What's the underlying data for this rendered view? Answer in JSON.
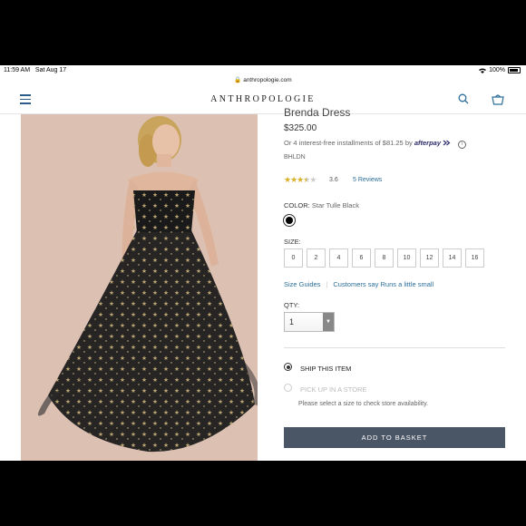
{
  "status": {
    "time": "11:59 AM",
    "date": "Sat Aug 17",
    "battery": "100%"
  },
  "browser": {
    "url": "anthropologie.com"
  },
  "header": {
    "logo": "ANTHROPOLOGIE"
  },
  "product": {
    "title": "Brenda Dress",
    "price": "$325.00",
    "installments": "Or 4 interest-free installments of $81.25 by",
    "afterpay": "afterpay",
    "brand": "BHLDN",
    "rating": "3.6",
    "rating_value": 3.6,
    "reviews": "5 Reviews",
    "color_label": "COLOR:",
    "color_value": "Star Tulle Black",
    "size_label": "SIZE:",
    "sizes": [
      "0",
      "2",
      "4",
      "6",
      "8",
      "10",
      "12",
      "14",
      "16"
    ],
    "size_guides": "Size Guides",
    "fit_note": "Customers say Runs a little small",
    "qty_label": "QTY:",
    "qty_value": "1",
    "ship_label": "SHIP THIS ITEM",
    "pickup_label": "PICK UP IN A STORE",
    "pickup_msg": "Please select a size to check store availability.",
    "basket_button": "ADD TO BASKET"
  },
  "colors": {
    "accent": "#2c6e9a",
    "button": "#4a5565",
    "star": "#d9b02a"
  }
}
